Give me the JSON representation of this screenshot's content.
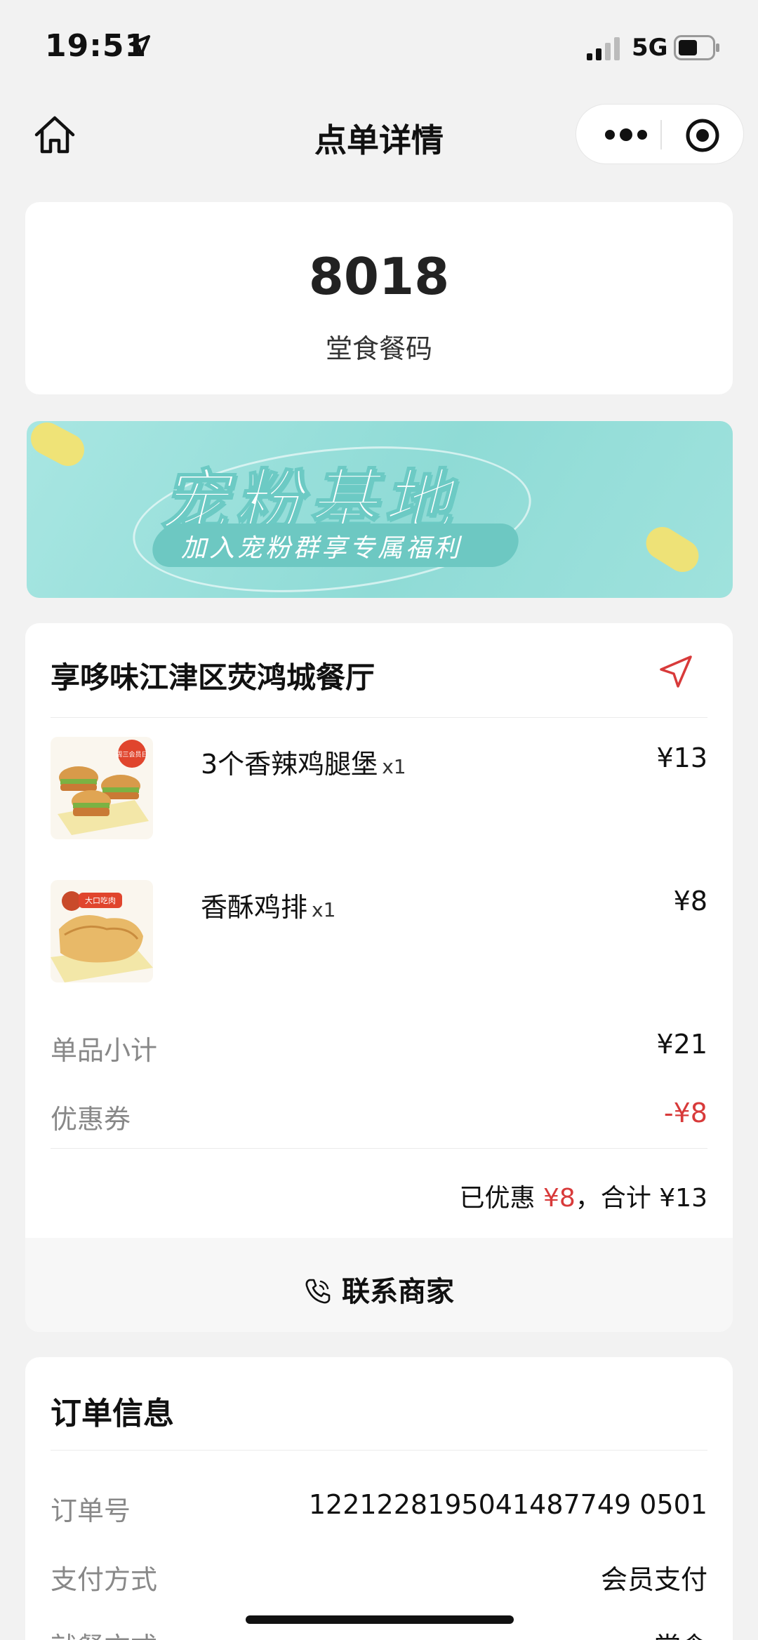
{
  "status_bar": {
    "time": "19:51",
    "network": "5G"
  },
  "nav": {
    "title": "点单详情"
  },
  "pickup": {
    "code": "8018",
    "label": "堂食餐码"
  },
  "banner": {
    "title": "宠粉基地",
    "subtitle": "加入宠粉群享专属福利"
  },
  "shop": {
    "name": "享哆味江津区荧鸿城餐厅",
    "items": [
      {
        "name": "3个香辣鸡腿堡",
        "qty": "x1",
        "price": "¥13",
        "image_badge": "周三会员日"
      },
      {
        "name": "香酥鸡排",
        "qty": "x1",
        "price": "¥8",
        "image_badge": "大口吃肉"
      }
    ],
    "subtotal_label": "单品小计",
    "subtotal_value": "¥21",
    "coupon_label": "优惠券",
    "coupon_value": "-¥8",
    "summary": {
      "discount_prefix": "已优惠",
      "discount_value": "¥8",
      "total_prefix": "，合计",
      "total_value": "¥13"
    },
    "contact_label": "联系商家"
  },
  "order_info": {
    "title": "订单信息",
    "rows": [
      {
        "label": "订单号",
        "value": "1221228195041487749 0501"
      },
      {
        "label": "支付方式",
        "value": "会员支付"
      },
      {
        "label": "就餐方式",
        "value": "堂食"
      }
    ]
  },
  "colors": {
    "accent_red": "#d83a3a",
    "banner_teal": "#8fdbd6"
  }
}
